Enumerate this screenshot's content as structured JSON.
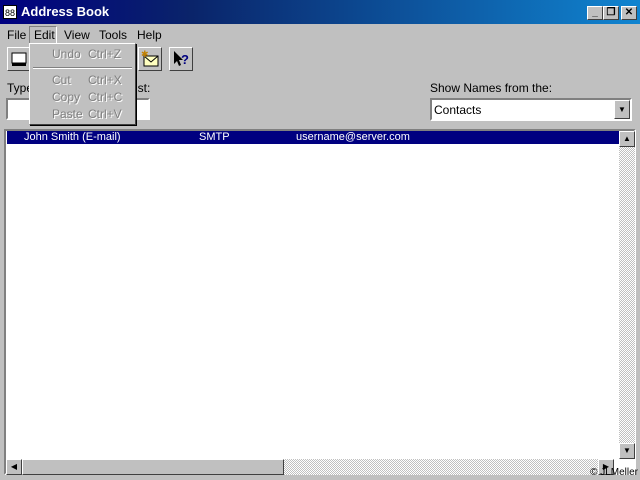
{
  "window": {
    "title": "Address Book",
    "icon_text": "88"
  },
  "menu": {
    "file": "File",
    "edit": "Edit",
    "view": "View",
    "tools": "Tools",
    "help": "Help"
  },
  "edit_menu": {
    "undo": "Undo",
    "undo_key": "Ctrl+Z",
    "cut": "Cut",
    "cut_key": "Ctrl+X",
    "copy": "Copy",
    "copy_key": "Ctrl+C",
    "paste": "Paste",
    "paste_key": "Ctrl+V"
  },
  "search": {
    "label_left": "Type",
    "label_right": "ist:",
    "value": ""
  },
  "show_names": {
    "label": "Show Names from the:",
    "selected": "Contacts"
  },
  "list": {
    "rows": [
      {
        "name": "John Smith (E-mail)",
        "type": "SMTP",
        "address": "username@server.com",
        "selected": true
      }
    ]
  },
  "icons": [
    "new-entry-icon",
    "new-message-icon",
    "whats-this-icon"
  ],
  "colors": {
    "titlebar": "#000080",
    "selection": "#000080",
    "face": "#c0c0c0"
  },
  "footer": {
    "copyright": "© JLMeller"
  }
}
